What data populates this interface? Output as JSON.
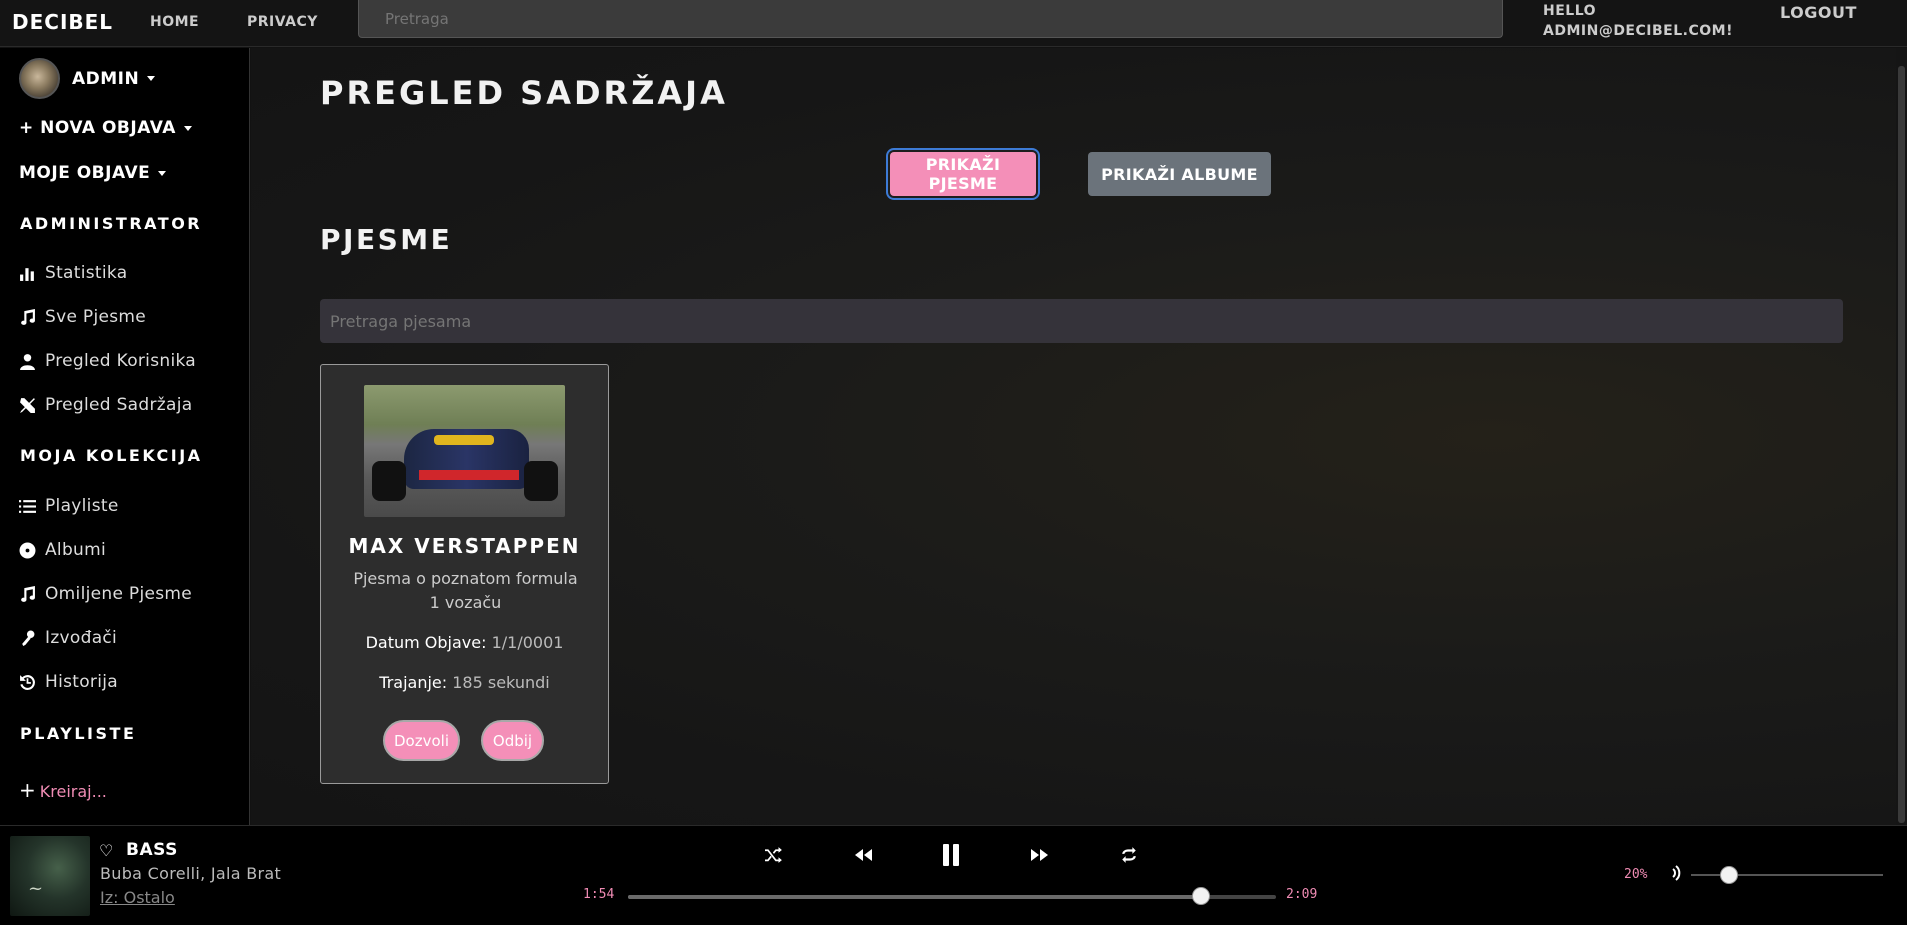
{
  "nav": {
    "brand": "DECIBEL",
    "home": "HOME",
    "privacy": "PRIVACY",
    "search_placeholder": "Pretraga",
    "hello_line1": "HELLO",
    "hello_line2": "ADMIN@DECIBEL.COM!",
    "logout": "LOGOUT"
  },
  "sidebar": {
    "user": "ADMIN",
    "new_post": "+ NOVA OBJAVA",
    "my_posts": "MOJE OBJAVE",
    "admin_section": "ADMINISTRATOR",
    "admin_items": [
      {
        "label": "Statistika",
        "icon": "chart-icon"
      },
      {
        "label": "Sve Pjesme",
        "icon": "music-note-icon"
      },
      {
        "label": "Pregled Korisnika",
        "icon": "user-icon"
      },
      {
        "label": "Pregled Sadržaja",
        "icon": "tools-icon"
      }
    ],
    "collection_section": "MOJA KOLEKCIJA",
    "collection_items": [
      {
        "label": "Playliste",
        "icon": "list-icon"
      },
      {
        "label": "Albumi",
        "icon": "disc-icon"
      },
      {
        "label": "Omiljene Pjesme",
        "icon": "music-note-icon"
      },
      {
        "label": "Izvođači",
        "icon": "microphone-icon"
      },
      {
        "label": "Historija",
        "icon": "history-icon"
      }
    ],
    "playlists_section": "PLAYLISTE",
    "create": "Kreiraj..."
  },
  "main": {
    "title": "PREGLED SADRŽAJA",
    "btn_songs": "PRIKAŽI PJESME",
    "btn_albums": "PRIKAŽI ALBUME",
    "section_title": "PJESME",
    "search_placeholder": "Pretraga pjesama",
    "card": {
      "title": "MAX VERSTAPPEN",
      "description": "Pjesma o poznatom formula 1 vozaču",
      "date_label": "Datum Objave:",
      "date_value": "1/1/0001",
      "duration_label": "Trajanje:",
      "duration_value": "185 sekundi",
      "allow": "Dozvoli",
      "deny": "Odbij"
    }
  },
  "player": {
    "title": "BASS",
    "artist": "Buba Corelli, Jala Brat",
    "album": "Iz: Ostalo",
    "elapsed": "1:54",
    "total": "2:09",
    "progress": 0.8837,
    "volume_label": "20%",
    "volume": 0.2,
    "accent": "#f08cb4"
  }
}
